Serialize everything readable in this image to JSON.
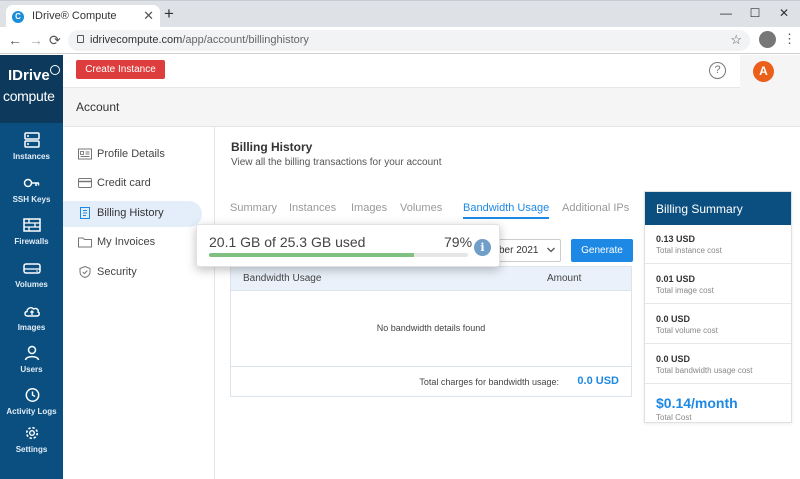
{
  "browser": {
    "tab_title": "IDrive® Compute",
    "tab_close": "✕",
    "new_tab": "+",
    "url_host": "idrivecompute.com",
    "url_path": "/app/account/billinghistory",
    "back_glyph": "←",
    "forward_glyph": "→",
    "reload_glyph": "⟳",
    "star_glyph": "☆",
    "menu_glyph": "⋮",
    "win_min": "—",
    "win_max": "☐",
    "win_close": "✕"
  },
  "brand": {
    "line1": "IDrive",
    "line2": "compute"
  },
  "sidebar": {
    "items": [
      {
        "label": "Instances",
        "icon": "server-icon"
      },
      {
        "label": "SSH Keys",
        "icon": "key-icon"
      },
      {
        "label": "Firewalls",
        "icon": "firewall-icon"
      },
      {
        "label": "Volumes",
        "icon": "volume-icon"
      },
      {
        "label": "Images",
        "icon": "cloud-upload-icon"
      },
      {
        "label": "Users",
        "icon": "user-icon"
      },
      {
        "label": "Activity Logs",
        "icon": "history-icon"
      },
      {
        "label": "Settings",
        "icon": "gear-icon"
      }
    ]
  },
  "header": {
    "create_label": "Create Instance",
    "help_glyph": "?",
    "avatar_initial": "A"
  },
  "account": {
    "title": "Account",
    "nav": [
      {
        "label": "Profile Details",
        "icon": "id-card-icon"
      },
      {
        "label": "Credit card",
        "icon": "credit-card-icon"
      },
      {
        "label": "Billing History",
        "icon": "invoice-icon"
      },
      {
        "label": "My Invoices",
        "icon": "folder-icon"
      },
      {
        "label": "Security",
        "icon": "shield-icon"
      }
    ]
  },
  "main": {
    "title": "Billing History",
    "subtitle": "View all the billing transactions for your account",
    "tabs": [
      "Summary",
      "Instances",
      "Images",
      "Volumes",
      "Bandwidth Usage",
      "Additional IPs"
    ],
    "active_tab": "Bandwidth Usage",
    "month_visible": "ber 2021",
    "generate_label": "Generate",
    "table": {
      "columns": [
        "Bandwidth Usage",
        "Amount"
      ],
      "empty_text": "No bandwidth details found",
      "total_label": "Total charges for bandwidth usage:",
      "total_value": "0.0 USD"
    }
  },
  "summary": {
    "title": "Billing Summary",
    "rows": [
      {
        "value": "0.13 USD",
        "label": "Total instance cost"
      },
      {
        "value": "0.01 USD",
        "label": "Total image cost"
      },
      {
        "value": "0.0 USD",
        "label": "Total volume cost"
      },
      {
        "value": "0.0 USD",
        "label": "Total bandwidth usage cost"
      }
    ],
    "total_value": "$0.14/month",
    "total_label": "Total Cost"
  },
  "usage": {
    "text": "20.1 GB of 25.3 GB used",
    "percent_label": "79%",
    "percent": 79,
    "info_glyph": "i"
  },
  "colors": {
    "sidebar": "#0b4f80",
    "accent": "#1e88e5",
    "create_button": "#de3d3d",
    "avatar": "#ea5f1a",
    "usage_fill": "#7fbf7f"
  }
}
